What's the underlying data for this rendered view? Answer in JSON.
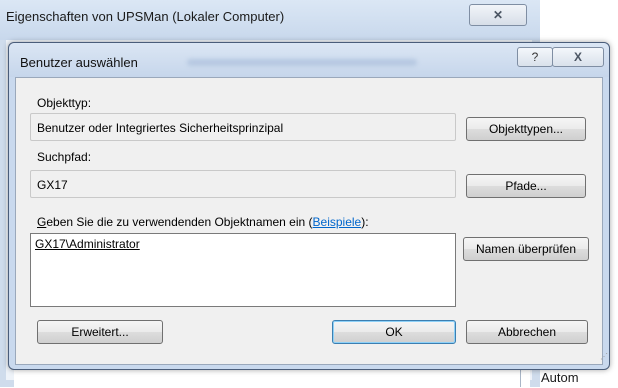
{
  "parent_window": {
    "title": "Eigenschaften von UPSMan (Lokaler Computer)",
    "close_icon": "close-icon",
    "bottom_text": "Autom"
  },
  "dialog": {
    "title": "Benutzer auswählen",
    "help_glyph": "?",
    "close_glyph": "X",
    "object_type": {
      "label": "Objekttyp:",
      "value": "Benutzer oder Integriertes Sicherheitsprinzipal",
      "button_label": "Objekttypen..."
    },
    "search_path": {
      "label": "Suchpfad:",
      "value": "GX17",
      "button_label": "Pfade..."
    },
    "names": {
      "prompt_underlined_letter": "G",
      "prompt_before_link": "eben Sie die zu verwendenden Objektnamen ein (",
      "link_label": "Beispiele",
      "prompt_after_link": "):",
      "value": "GX17\\Administrator",
      "check_button_label": "Namen überprüfen"
    },
    "buttons": {
      "advanced": "Erweitert...",
      "ok": "OK",
      "cancel": "Abbrechen"
    }
  },
  "colors": {
    "dialog_frame": "#c9d9ee",
    "body": "#f0f0f0",
    "link": "#0066cc"
  }
}
